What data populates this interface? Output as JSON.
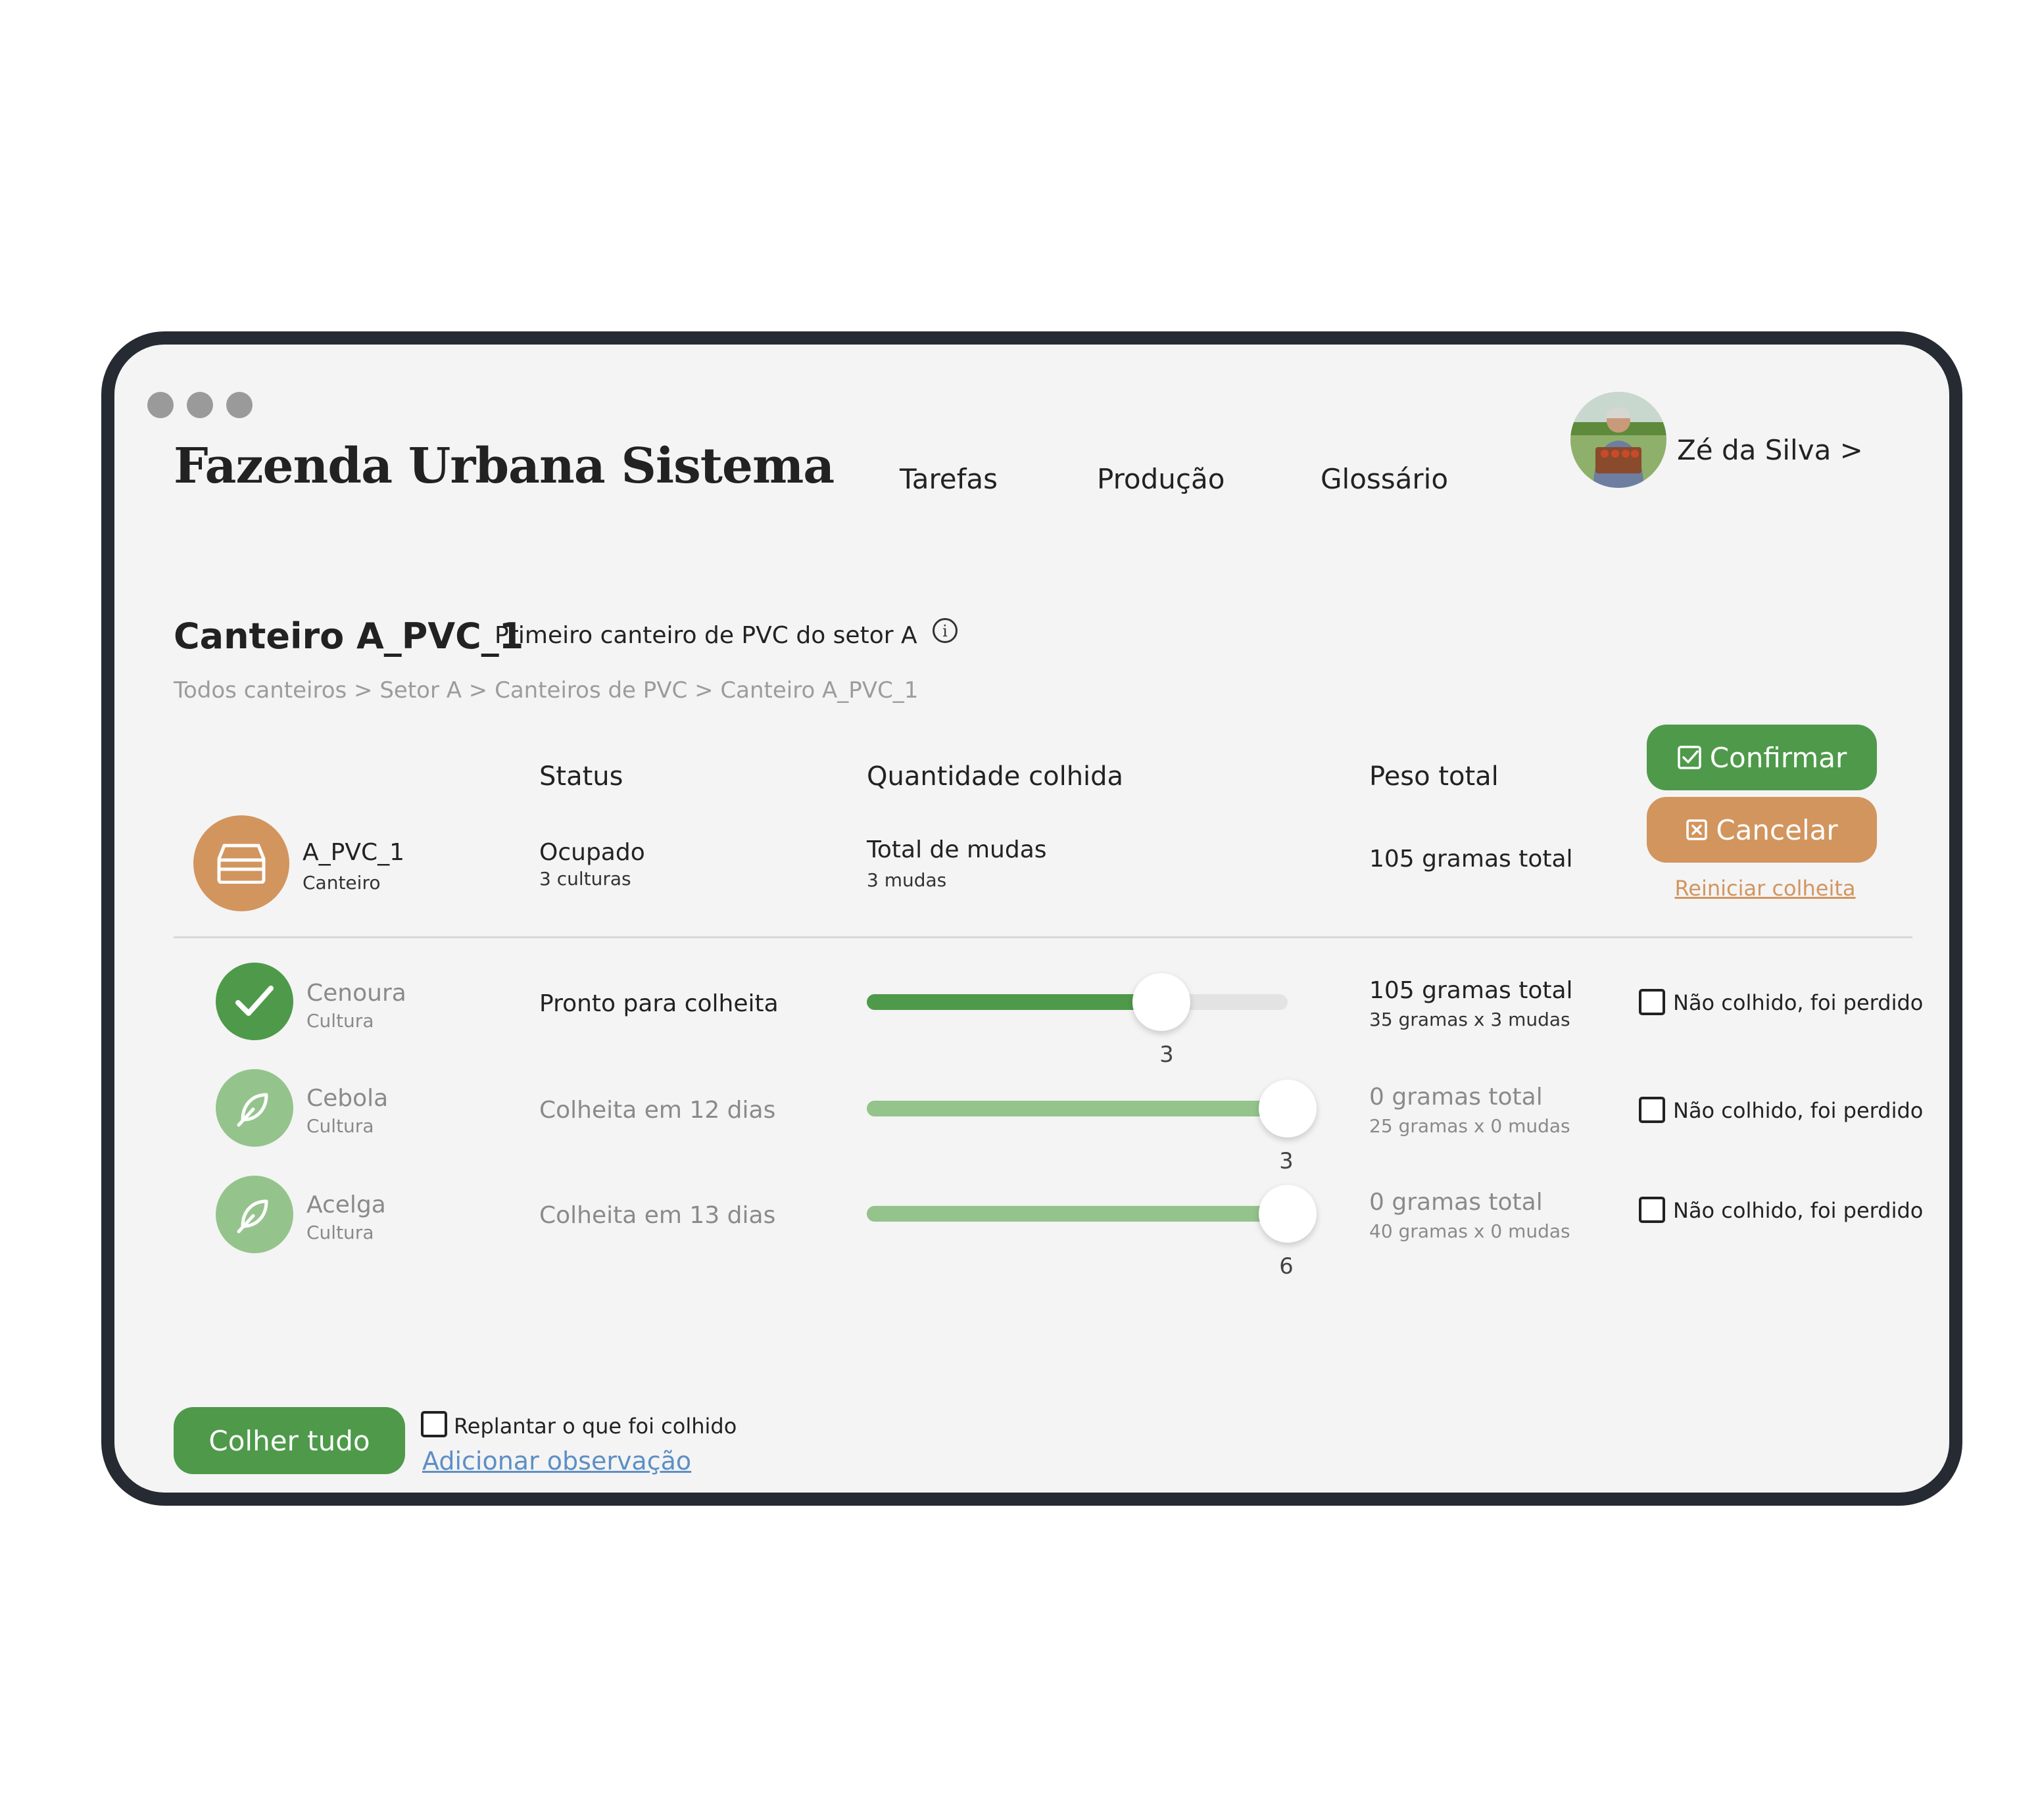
{
  "app": {
    "title": "Fazenda Urbana Sistema",
    "nav": [
      "Tarefas",
      "Produção",
      "Glossário"
    ],
    "user": "Zé da Silva >"
  },
  "bed": {
    "name": "Canteiro A_PVC_1",
    "description": "Primeiro canteiro de PVC do setor A",
    "breadcrumb": "Todos canteiros > Setor A > Canteiros de PVC > Canteiro A_PVC_1"
  },
  "columns": {
    "status": "Status",
    "quantity": "Quantidade colhida",
    "weight": "Peso total"
  },
  "summary": {
    "id": "A_PVC_1",
    "type": "Canteiro",
    "status": "Ocupado",
    "status_detail": "3 culturas",
    "quantity": "Total de mudas",
    "quantity_detail": "3 mudas",
    "weight": "105 gramas total"
  },
  "actions": {
    "confirm": "Confirmar",
    "cancel": "Cancelar",
    "reset": "Reiniciar colheita"
  },
  "crops": [
    {
      "name": "Cenoura",
      "type": "Cultura",
      "status": "Pronto para colheita",
      "slider_value": "3",
      "slider_fraction": 0.7,
      "weight_total": "105 gramas total",
      "weight_detail": "35 gramas x 3 mudas",
      "lost_label": "Não colhido, foi perdido",
      "icon": "check-icon",
      "color": "#4e9a4a"
    },
    {
      "name": "Cebola",
      "type": "Cultura",
      "status": "Colheita em 12 dias",
      "slider_value": "3",
      "slider_fraction": 1.0,
      "weight_total": "0 gramas total",
      "weight_detail": "25 gramas x 0 mudas",
      "lost_label": "Não colhido, foi perdido",
      "icon": "leaf-icon",
      "color": "#94c48c"
    },
    {
      "name": "Acelga",
      "type": "Cultura",
      "status": "Colheita em 13 dias",
      "slider_value": "6",
      "slider_fraction": 1.0,
      "weight_total": "0 gramas total",
      "weight_detail": "40 gramas x 0 mudas",
      "lost_label": "Não colhido, foi perdido",
      "icon": "leaf-icon",
      "color": "#94c48c"
    }
  ],
  "footer": {
    "harvest_all": "Colher tudo",
    "replant": "Replantar o que foi colhido",
    "add_note": "Adicionar observação"
  },
  "colors": {
    "green": "#4e9a4a",
    "light_green": "#94c48c",
    "orange": "#d2955e",
    "frame": "#252a33"
  }
}
